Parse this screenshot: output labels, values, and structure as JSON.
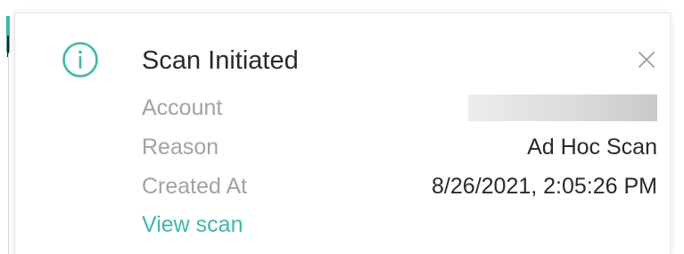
{
  "notification": {
    "title": "Scan Initiated",
    "icon": "info-icon",
    "close_icon": "close-icon",
    "accent_color": "#3fb8a4",
    "rows": [
      {
        "label": "Account",
        "value": ""
      },
      {
        "label": "Reason",
        "value": "Ad Hoc Scan"
      },
      {
        "label": "Created At",
        "value": "8/26/2021, 2:05:26 PM"
      }
    ],
    "link_label": "View scan"
  }
}
